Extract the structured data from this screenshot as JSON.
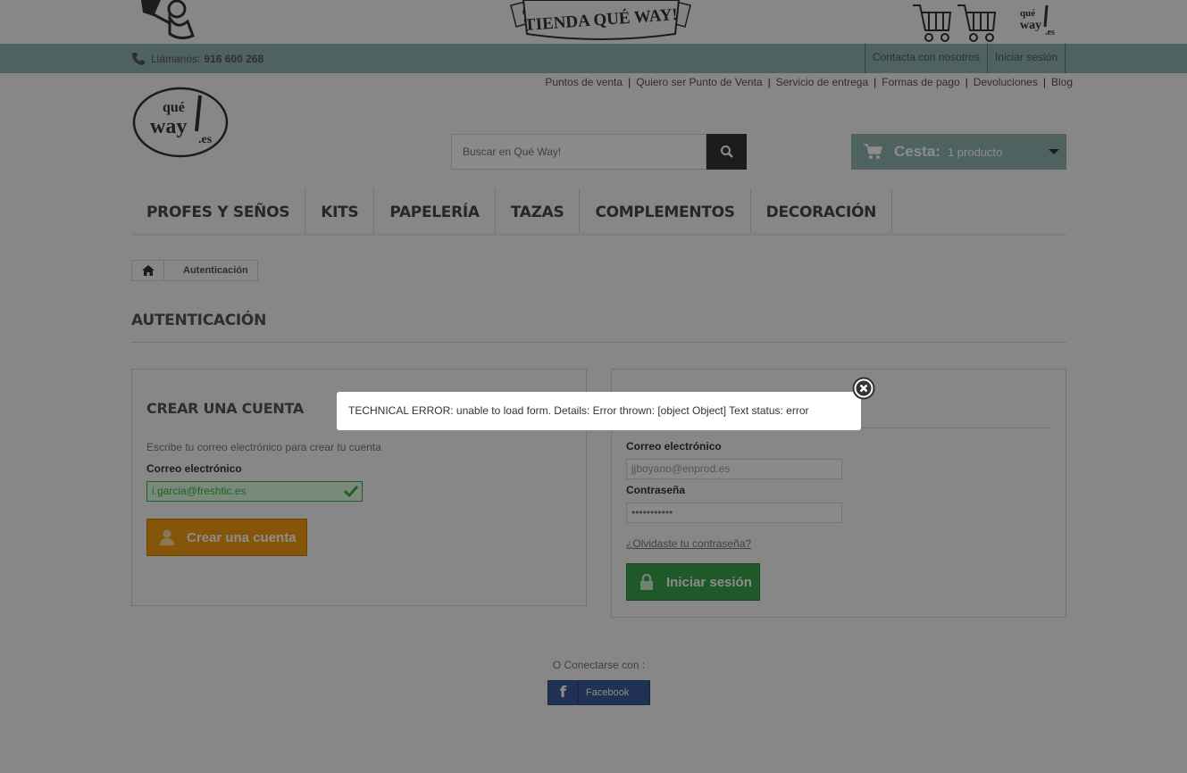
{
  "banner": {
    "ribbon_text": "TIENDA QUÉ WAY!",
    "carts_logo_text": "qué way!.es"
  },
  "navbar": {
    "phone_label": "Llámanos:",
    "phone_number": "916 600 268",
    "links": [
      "Contacta con nosotros",
      "Iniciar sesión"
    ]
  },
  "info_links": [
    "Puntos de venta",
    "Quiero ser Punto de Venta",
    "Servicio de entrega",
    "Formas de pago",
    "Devoluciones",
    "Blog"
  ],
  "info_separator": "|",
  "logo_text": "qué way!.es",
  "search": {
    "placeholder": "Buscar en Qué Way!"
  },
  "cart": {
    "label": "Cesta:",
    "quantity": "1 producto"
  },
  "menu": [
    "PROFES Y SEÑOS",
    "KITS",
    "PAPELERÍA",
    "TAZAS",
    "COMPLEMENTOS",
    "DECORACIÓN"
  ],
  "breadcrumb": {
    "current": "Autenticación"
  },
  "page_title": "AUTENTICACIÓN",
  "create_account": {
    "title": "CREAR UNA CUENTA",
    "intro": "Escribe tu correo electrónico para crear tu cuenta",
    "email_label": "Correo electrónico",
    "email_value": "i.garcia@freshtic.es",
    "button": "Crear una cuenta"
  },
  "login": {
    "email_label": "Correo electrónico",
    "email_value": "jjboyano@enprod.es",
    "password_label": "Contraseña",
    "password_value": "•••••••••••",
    "forgot": "¿Olvidaste tu contraseña?",
    "button": "Iniciar sesión"
  },
  "social": {
    "connect_label": "O Conectarse con :",
    "facebook_label": "Facebook"
  },
  "modal": {
    "message": "TECHNICAL ERROR: unable to load form. Details: Error thrown: [object Object] Text status: error"
  },
  "colors": {
    "navbar": "#8eb4ad",
    "create_button": "#f39c11",
    "login_button": "#3aa04c",
    "facebook": "#3b5998"
  }
}
